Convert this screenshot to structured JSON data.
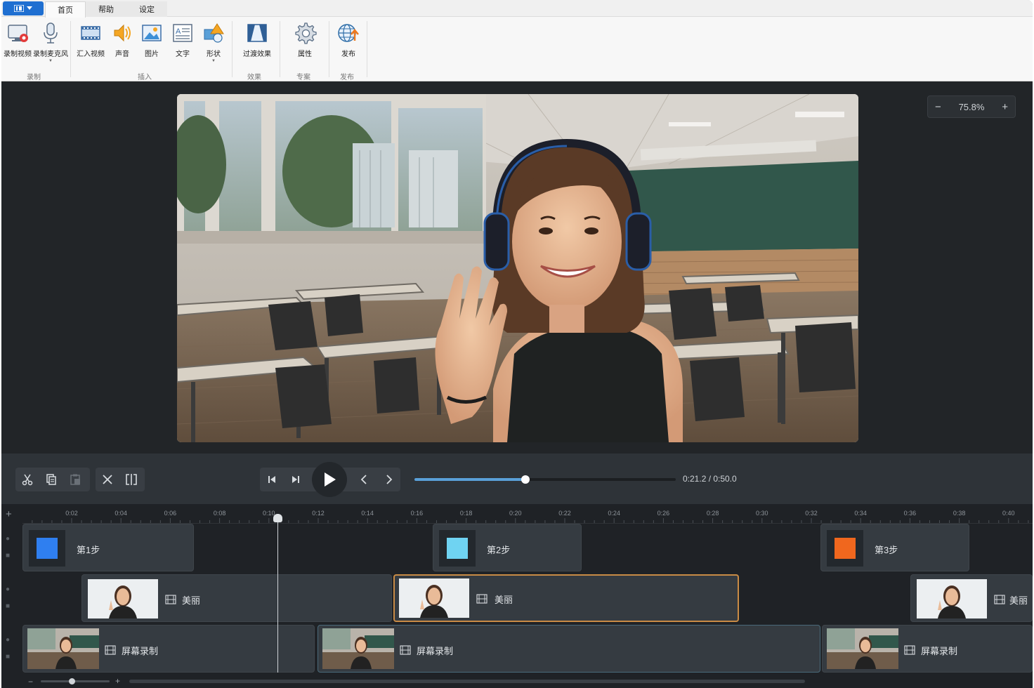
{
  "ribbon": {
    "tabs": [
      {
        "label": "首页",
        "active": true
      },
      {
        "label": "帮助",
        "active": false
      },
      {
        "label": "设定",
        "active": false
      }
    ],
    "app_menu_icon": "app-menu-icon",
    "buttons": {
      "record_video": "录制视频",
      "record_mic": "录制麦克风",
      "import_video": "汇入视频",
      "sound": "声音",
      "image": "图片",
      "text": "文字",
      "shape": "形状",
      "transition": "过渡效果",
      "properties": "属性",
      "publish": "发布"
    },
    "groups": {
      "record": "录制",
      "insert": "插入",
      "effects": "效果",
      "project": "专案",
      "publish": "发布"
    }
  },
  "preview": {
    "zoom_minus": "−",
    "zoom_value": "75.8%",
    "zoom_plus": "+"
  },
  "playback": {
    "progress": 0.424,
    "timecode": "0:21.2 / 0:50.0"
  },
  "timeline": {
    "add": "+",
    "ruler_ticks": [
      "0:02",
      "0:04",
      "0:06",
      "0:08",
      "0:10",
      "0:12",
      "0:14",
      "0:16",
      "0:18",
      "0:20",
      "0:22",
      "0:24",
      "0:26",
      "0:28",
      "0:30",
      "0:32",
      "0:34",
      "0:36",
      "0:38",
      "0:40"
    ],
    "track1": [
      {
        "label": "第1步",
        "color": "#2f7ff0"
      },
      {
        "label": "第2步",
        "color": "#6fd3f2"
      },
      {
        "label": "第3步",
        "color": "#f0671e"
      }
    ],
    "track2": [
      {
        "label": "美丽"
      },
      {
        "label": "美丽"
      },
      {
        "label": "美丽"
      }
    ],
    "track3": [
      {
        "label": "屏幕录制"
      },
      {
        "label": "屏幕录制"
      },
      {
        "label": "屏幕录制"
      }
    ],
    "zoom_minus": "−",
    "zoom_plus": "+",
    "zoom_level": 0.45
  },
  "colors": {
    "accent": "#1f6fd1",
    "seek_fill": "#5aa0d8",
    "selected_clip_border": "#c98b45"
  }
}
